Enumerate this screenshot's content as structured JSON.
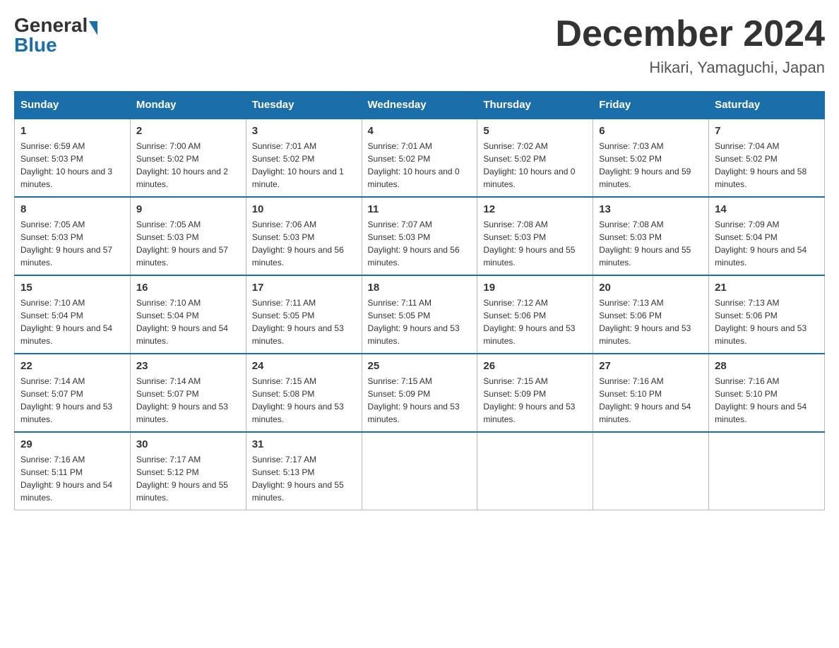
{
  "header": {
    "logo": {
      "part1": "General",
      "part2": "Blue"
    },
    "title": "December 2024",
    "subtitle": "Hikari, Yamaguchi, Japan"
  },
  "weekdays": [
    "Sunday",
    "Monday",
    "Tuesday",
    "Wednesday",
    "Thursday",
    "Friday",
    "Saturday"
  ],
  "weeks": [
    [
      {
        "day": "1",
        "sunrise": "6:59 AM",
        "sunset": "5:03 PM",
        "daylight": "10 hours and 3 minutes."
      },
      {
        "day": "2",
        "sunrise": "7:00 AM",
        "sunset": "5:02 PM",
        "daylight": "10 hours and 2 minutes."
      },
      {
        "day": "3",
        "sunrise": "7:01 AM",
        "sunset": "5:02 PM",
        "daylight": "10 hours and 1 minute."
      },
      {
        "day": "4",
        "sunrise": "7:01 AM",
        "sunset": "5:02 PM",
        "daylight": "10 hours and 0 minutes."
      },
      {
        "day": "5",
        "sunrise": "7:02 AM",
        "sunset": "5:02 PM",
        "daylight": "10 hours and 0 minutes."
      },
      {
        "day": "6",
        "sunrise": "7:03 AM",
        "sunset": "5:02 PM",
        "daylight": "9 hours and 59 minutes."
      },
      {
        "day": "7",
        "sunrise": "7:04 AM",
        "sunset": "5:02 PM",
        "daylight": "9 hours and 58 minutes."
      }
    ],
    [
      {
        "day": "8",
        "sunrise": "7:05 AM",
        "sunset": "5:03 PM",
        "daylight": "9 hours and 57 minutes."
      },
      {
        "day": "9",
        "sunrise": "7:05 AM",
        "sunset": "5:03 PM",
        "daylight": "9 hours and 57 minutes."
      },
      {
        "day": "10",
        "sunrise": "7:06 AM",
        "sunset": "5:03 PM",
        "daylight": "9 hours and 56 minutes."
      },
      {
        "day": "11",
        "sunrise": "7:07 AM",
        "sunset": "5:03 PM",
        "daylight": "9 hours and 56 minutes."
      },
      {
        "day": "12",
        "sunrise": "7:08 AM",
        "sunset": "5:03 PM",
        "daylight": "9 hours and 55 minutes."
      },
      {
        "day": "13",
        "sunrise": "7:08 AM",
        "sunset": "5:03 PM",
        "daylight": "9 hours and 55 minutes."
      },
      {
        "day": "14",
        "sunrise": "7:09 AM",
        "sunset": "5:04 PM",
        "daylight": "9 hours and 54 minutes."
      }
    ],
    [
      {
        "day": "15",
        "sunrise": "7:10 AM",
        "sunset": "5:04 PM",
        "daylight": "9 hours and 54 minutes."
      },
      {
        "day": "16",
        "sunrise": "7:10 AM",
        "sunset": "5:04 PM",
        "daylight": "9 hours and 54 minutes."
      },
      {
        "day": "17",
        "sunrise": "7:11 AM",
        "sunset": "5:05 PM",
        "daylight": "9 hours and 53 minutes."
      },
      {
        "day": "18",
        "sunrise": "7:11 AM",
        "sunset": "5:05 PM",
        "daylight": "9 hours and 53 minutes."
      },
      {
        "day": "19",
        "sunrise": "7:12 AM",
        "sunset": "5:06 PM",
        "daylight": "9 hours and 53 minutes."
      },
      {
        "day": "20",
        "sunrise": "7:13 AM",
        "sunset": "5:06 PM",
        "daylight": "9 hours and 53 minutes."
      },
      {
        "day": "21",
        "sunrise": "7:13 AM",
        "sunset": "5:06 PM",
        "daylight": "9 hours and 53 minutes."
      }
    ],
    [
      {
        "day": "22",
        "sunrise": "7:14 AM",
        "sunset": "5:07 PM",
        "daylight": "9 hours and 53 minutes."
      },
      {
        "day": "23",
        "sunrise": "7:14 AM",
        "sunset": "5:07 PM",
        "daylight": "9 hours and 53 minutes."
      },
      {
        "day": "24",
        "sunrise": "7:15 AM",
        "sunset": "5:08 PM",
        "daylight": "9 hours and 53 minutes."
      },
      {
        "day": "25",
        "sunrise": "7:15 AM",
        "sunset": "5:09 PM",
        "daylight": "9 hours and 53 minutes."
      },
      {
        "day": "26",
        "sunrise": "7:15 AM",
        "sunset": "5:09 PM",
        "daylight": "9 hours and 53 minutes."
      },
      {
        "day": "27",
        "sunrise": "7:16 AM",
        "sunset": "5:10 PM",
        "daylight": "9 hours and 54 minutes."
      },
      {
        "day": "28",
        "sunrise": "7:16 AM",
        "sunset": "5:10 PM",
        "daylight": "9 hours and 54 minutes."
      }
    ],
    [
      {
        "day": "29",
        "sunrise": "7:16 AM",
        "sunset": "5:11 PM",
        "daylight": "9 hours and 54 minutes."
      },
      {
        "day": "30",
        "sunrise": "7:17 AM",
        "sunset": "5:12 PM",
        "daylight": "9 hours and 55 minutes."
      },
      {
        "day": "31",
        "sunrise": "7:17 AM",
        "sunset": "5:13 PM",
        "daylight": "9 hours and 55 minutes."
      },
      null,
      null,
      null,
      null
    ]
  ],
  "labels": {
    "sunrise": "Sunrise:",
    "sunset": "Sunset:",
    "daylight": "Daylight:"
  }
}
